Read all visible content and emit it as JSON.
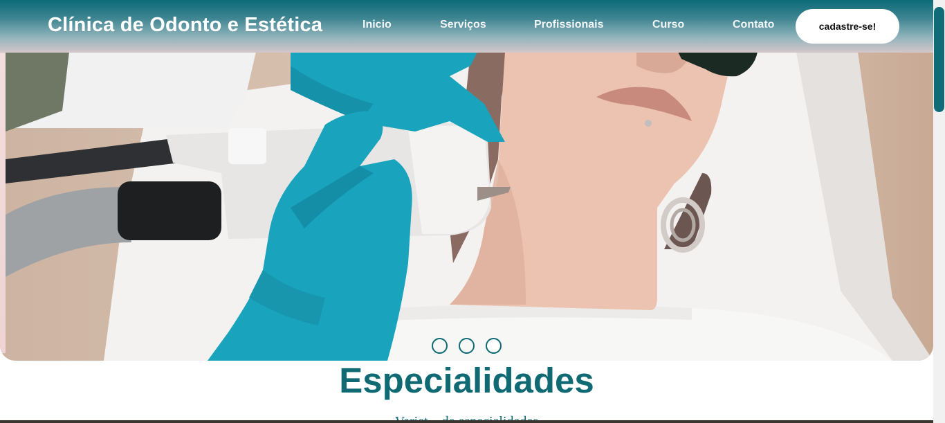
{
  "header": {
    "brand": "Clínica de Odonto e Estética",
    "nav": [
      {
        "label": "Inicio"
      },
      {
        "label": "Serviços"
      },
      {
        "label": "Profissionais"
      },
      {
        "label": "Curso"
      },
      {
        "label": "Contato"
      }
    ],
    "cta_label": "cadastre-se!"
  },
  "carousel": {
    "slide_count": 3,
    "active_index": 3,
    "slide_description": "Esthetic laser treatment photo: gloved hands operating a laser device on a patient's neck"
  },
  "section": {
    "title": "Especialidades",
    "subtitle": "Variet... de especialidades"
  },
  "colors": {
    "brand_teal": "#0f6a73",
    "glove_blue": "#1aa3bd",
    "header_gradient_top": "#0c6b78"
  }
}
